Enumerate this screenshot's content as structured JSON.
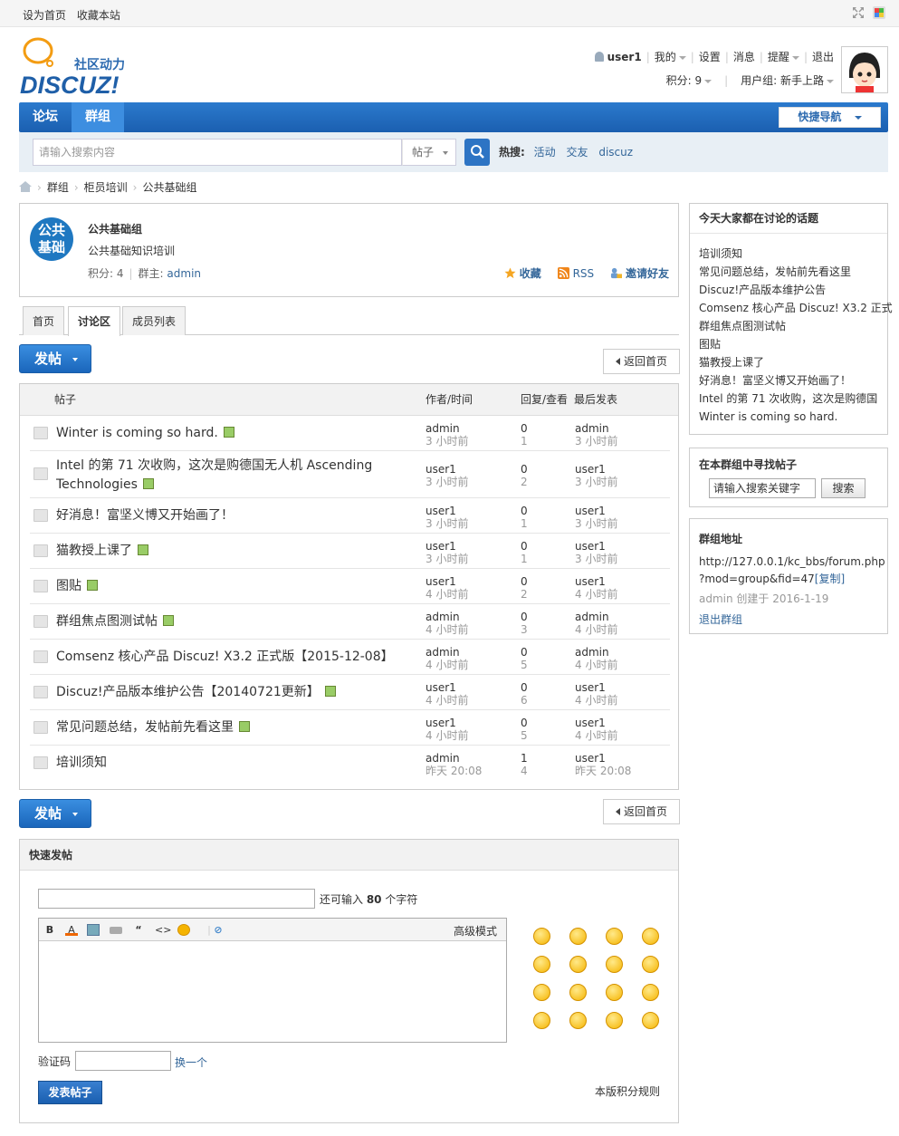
{
  "topbar": {
    "set_home": "设为首页",
    "bookmark": "收藏本站"
  },
  "logo": {
    "cn": "社区动力",
    "en": "DISCUZ!"
  },
  "user": {
    "name": "user1",
    "my": "我的",
    "settings": "设置",
    "messages": "消息",
    "remind": "提醒",
    "logout": "退出",
    "points": "积分: 9",
    "group": "用户组: 新手上路"
  },
  "nav": {
    "items": [
      "论坛",
      "群组"
    ],
    "active": "群组",
    "quicknav": "快捷导航"
  },
  "search": {
    "placeholder": "请输入搜索内容",
    "type": "帖子",
    "hot_label": "热搜:",
    "hot": [
      "活动",
      "交友",
      "discuz"
    ]
  },
  "breadcrumb": [
    "群组",
    "柜员培训",
    "公共基础组"
  ],
  "group": {
    "logo_line1": "公共",
    "logo_line2": "基础",
    "name": "公共基础组",
    "desc": "公共基础知识培训",
    "points_label": "积分: ",
    "points": "4",
    "owner_label": "群主: ",
    "owner": "admin",
    "fav": "收藏",
    "rss": "RSS",
    "invite": "邀请好友"
  },
  "tabs": [
    "首页",
    "讨论区",
    "成员列表"
  ],
  "buttons": {
    "post": "发帖",
    "back": "返回首页"
  },
  "thread_head": {
    "subject": "帖子",
    "author": "作者/时间",
    "replies": "回复/查看",
    "last": "最后发表"
  },
  "threads": [
    {
      "title": "Winter is coming so hard.",
      "title2": "",
      "att": true,
      "author": "admin",
      "time": "3 小时前",
      "replies": "0",
      "views": "1",
      "last_user": "admin",
      "last_time": "3 小时前"
    },
    {
      "title": "Intel 的第 71 次收购，这次是购德国无人机 Ascending",
      "title2": "Technologies",
      "att": true,
      "author": "user1",
      "time": "3 小时前",
      "replies": "0",
      "views": "2",
      "last_user": "user1",
      "last_time": "3 小时前"
    },
    {
      "title": "好消息！富坚义博又开始画了！",
      "title2": "",
      "att": false,
      "author": "user1",
      "time": "3 小时前",
      "replies": "0",
      "views": "1",
      "last_user": "user1",
      "last_time": "3 小时前"
    },
    {
      "title": "猫教授上课了",
      "title2": "",
      "att": true,
      "author": "user1",
      "time": "3 小时前",
      "replies": "0",
      "views": "1",
      "last_user": "user1",
      "last_time": "3 小时前"
    },
    {
      "title": "图贴",
      "title2": "",
      "att": true,
      "author": "user1",
      "time": "4 小时前",
      "replies": "0",
      "views": "2",
      "last_user": "user1",
      "last_time": "4 小时前"
    },
    {
      "title": "群组焦点图测试帖",
      "title2": "",
      "att": true,
      "author": "admin",
      "time": "4 小时前",
      "replies": "0",
      "views": "3",
      "last_user": "admin",
      "last_time": "4 小时前"
    },
    {
      "title": "Comsenz 核心产品 Discuz! X3.2 正式版【2015-12-08】",
      "title2": "",
      "att": false,
      "author": "admin",
      "time": "4 小时前",
      "replies": "0",
      "views": "5",
      "last_user": "admin",
      "last_time": "4 小时前"
    },
    {
      "title": "Discuz!产品版本维护公告【20140721更新】",
      "title2": "",
      "att": true,
      "author": "user1",
      "time": "4 小时前",
      "replies": "0",
      "views": "6",
      "last_user": "user1",
      "last_time": "4 小时前"
    },
    {
      "title": "常见问题总结，发帖前先看这里",
      "title2": "",
      "att": true,
      "author": "user1",
      "time": "4 小时前",
      "replies": "0",
      "views": "5",
      "last_user": "user1",
      "last_time": "4 小时前"
    },
    {
      "title": "培训须知",
      "title2": "",
      "att": false,
      "author": "admin",
      "time": "昨天 20:08",
      "replies": "1",
      "views": "4",
      "last_user": "user1",
      "last_time": "昨天 20:08"
    }
  ],
  "quickpost": {
    "title": "快速发帖",
    "remain_prefix": "还可输入 ",
    "remain_count": "80",
    "remain_suffix": " 个字符",
    "advanced": "高级模式",
    "captcha": "验证码",
    "change": "换一个",
    "submit": "发表帖子",
    "rules": "本版积分规则"
  },
  "sidebar": {
    "hot_title": "今天大家都在讨论的话题",
    "hot_items": [
      "培训须知",
      "常见问题总结，发帖前先看这里",
      "Discuz!产品版本维护公告",
      "Comsenz 核心产品 Discuz! X3.2 正式",
      "群组焦点图测试帖",
      "图贴",
      "猫教授上课了",
      "好消息！富坚义博又开始画了！",
      "Intel 的第 71 次收购，这次是购德国",
      "Winter is coming so hard."
    ],
    "search_title": "在本群组中寻找帖子",
    "search_placeholder": "请输入搜索关键字",
    "search_btn": "搜索",
    "addr_title": "群组地址",
    "addr_line1": "http://127.0.0.1/kc_bbs/forum.php",
    "addr_line2": "?mod=group&fid=47",
    "copy": "[复制]",
    "created": "admin 创建于 2016-1-19",
    "quit": "退出群组"
  }
}
